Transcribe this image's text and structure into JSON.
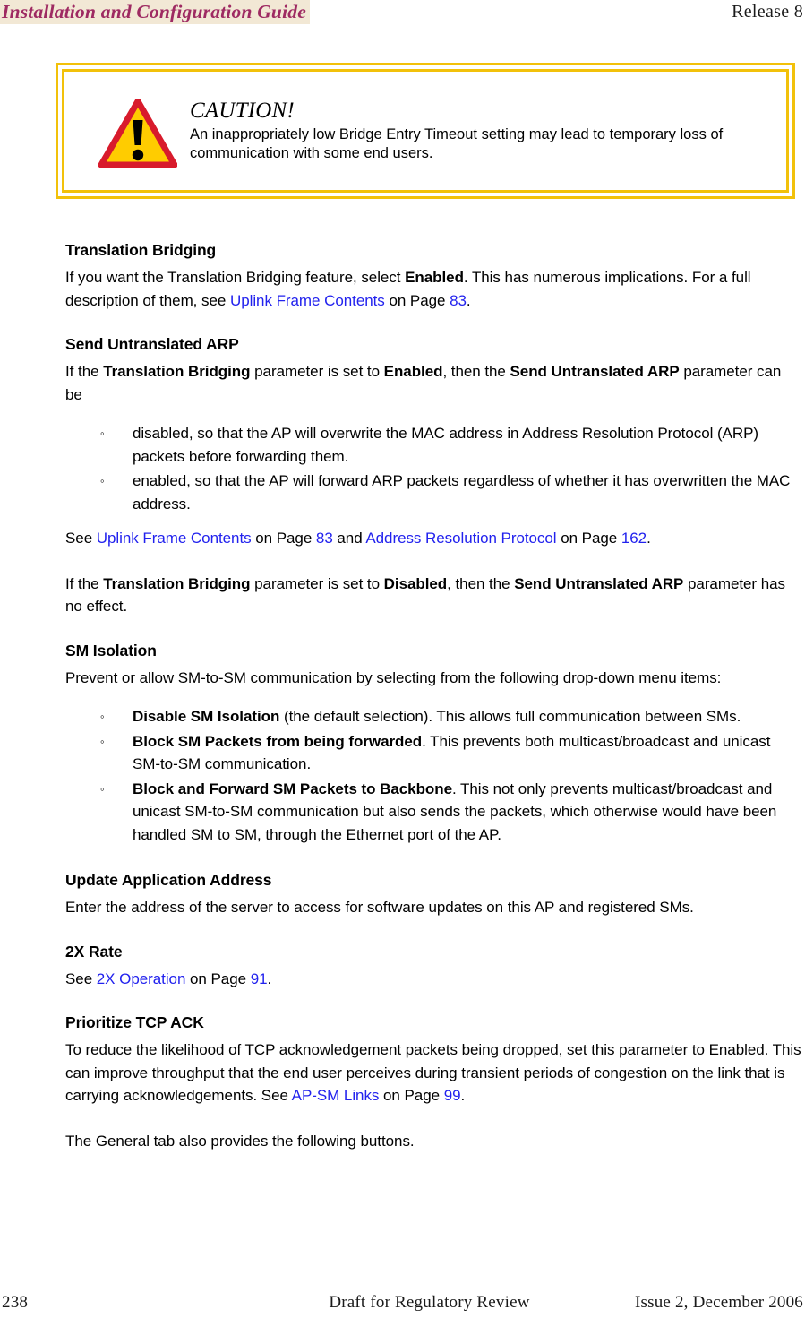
{
  "header": {
    "title": "Installation and Configuration Guide",
    "release": "Release 8",
    "title_color": "#9e2a62",
    "highlight_color": "#f2e8d5"
  },
  "caution": {
    "icon": "warning-triangle-icon",
    "heading": "CAUTION!",
    "text": "An inappropriately low Bridge Entry Timeout setting may lead to temporary loss of communication with some end users.",
    "border_color": "#f2c10a",
    "triangle_fill": "#ffcc00",
    "triangle_stroke": "#d81b2c"
  },
  "sections": {
    "translation_bridging": {
      "heading": "Translation Bridging",
      "p1_a": "If you want the Translation Bridging feature, select ",
      "p1_b": "Enabled",
      "p1_c": ". This has numerous implications. For a full description of them, see ",
      "p1_xref": "Uplink Frame Contents",
      "p1_d": " on Page ",
      "p1_page": "83",
      "p1_e": "."
    },
    "send_untranslated_arp": {
      "heading": "Send Untranslated ARP",
      "p1_a": "If the ",
      "p1_b": "Translation Bridging",
      "p1_c": " parameter is set to ",
      "p1_d": "Enabled",
      "p1_e": ", then the ",
      "p1_f": "Send Untranslated ARP",
      "p1_g": " parameter can be",
      "bullets": [
        "disabled, so that the AP will overwrite the MAC address in Address Resolution Protocol (ARP) packets before forwarding them.",
        "enabled, so that the AP will forward ARP packets regardless of whether it has overwritten the MAC address."
      ],
      "p2_a": "See ",
      "p2_xref1": "Uplink Frame Contents",
      "p2_b": " on Page ",
      "p2_page1": "83",
      "p2_c": " and ",
      "p2_xref2": "Address Resolution Protocol",
      "p2_d": " on Page ",
      "p2_page2": "162",
      "p2_e": ".",
      "p3_a": "If the ",
      "p3_b": "Translation Bridging",
      "p3_c": " parameter is set to ",
      "p3_d": "Disabled",
      "p3_e": ", then the ",
      "p3_f": "Send Untranslated ARP",
      "p3_g": " parameter has no effect."
    },
    "sm_isolation": {
      "heading": "SM Isolation",
      "p1": "Prevent or allow SM-to-SM communication by selecting from the following drop-down menu items:",
      "bullets": [
        {
          "bold": "Disable SM Isolation",
          "rest": " (the default selection). This allows full communication between SMs."
        },
        {
          "bold": "Block SM Packets from being forwarded",
          "rest": ". This prevents both multicast/broadcast and unicast SM-to-SM communication."
        },
        {
          "bold": "Block and Forward SM Packets to Backbone",
          "rest": ". This not only prevents multicast/broadcast and unicast SM-to-SM communication but also sends the packets, which otherwise would have been handled SM to SM, through the Ethernet port of the AP."
        }
      ]
    },
    "update_application_address": {
      "heading": "Update Application Address",
      "p1": "Enter the address of the server to access for software updates on this AP and registered SMs."
    },
    "two_x_rate": {
      "heading": "2X Rate",
      "p1_a": "See ",
      "p1_xref": "2X Operation",
      "p1_b": " on Page ",
      "p1_page": "91",
      "p1_c": "."
    },
    "prioritize_tcp_ack": {
      "heading": "Prioritize TCP ACK",
      "p1_a": "To reduce the likelihood of TCP acknowledgement packets being dropped, set this parameter to Enabled. This can improve throughput that the end user perceives during transient periods of congestion on the link that is carrying acknowledgements. See ",
      "p1_xref": "AP-SM Links",
      "p1_b": " on Page ",
      "p1_page": "99",
      "p1_c": "."
    },
    "closing": {
      "p1": "The General tab also provides the following buttons."
    }
  },
  "footer": {
    "page_number": "238",
    "center": "Draft for Regulatory Review",
    "right": "Issue 2, December 2006"
  },
  "bullet_glyph": "◦"
}
